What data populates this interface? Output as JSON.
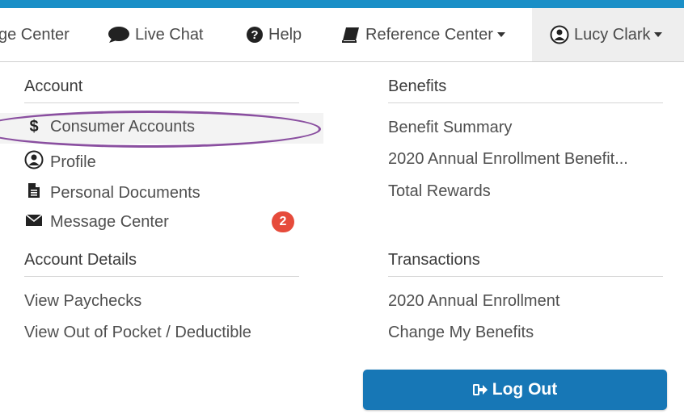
{
  "nav": {
    "message_center": "ge Center",
    "live_chat": "Live Chat",
    "help": "Help",
    "reference_center": "Reference Center",
    "user": "Lucy Clark"
  },
  "account": {
    "heading": "Account",
    "items": [
      {
        "label": "Consumer Accounts",
        "icon": "dollar-icon"
      },
      {
        "label": "Profile",
        "icon": "user-circle-icon"
      },
      {
        "label": "Personal Documents",
        "icon": "document-icon"
      },
      {
        "label": "Message Center",
        "icon": "envelope-icon",
        "badge": "2"
      }
    ]
  },
  "account_details": {
    "heading": "Account Details",
    "items": [
      "View Paychecks",
      "View Out of Pocket / Deductible"
    ]
  },
  "benefits": {
    "heading": "Benefits",
    "items": [
      "Benefit Summary",
      "2020 Annual Enrollment Benefit...",
      "Total Rewards"
    ]
  },
  "transactions": {
    "heading": "Transactions",
    "items": [
      "2020 Annual Enrollment",
      "Change My Benefits"
    ]
  },
  "logout_label": "Log Out",
  "colors": {
    "topbar": "#1a8fc7",
    "highlight_ellipse": "#8a4fa0",
    "badge": "#e64b3b",
    "logout_button": "#1777b6"
  }
}
